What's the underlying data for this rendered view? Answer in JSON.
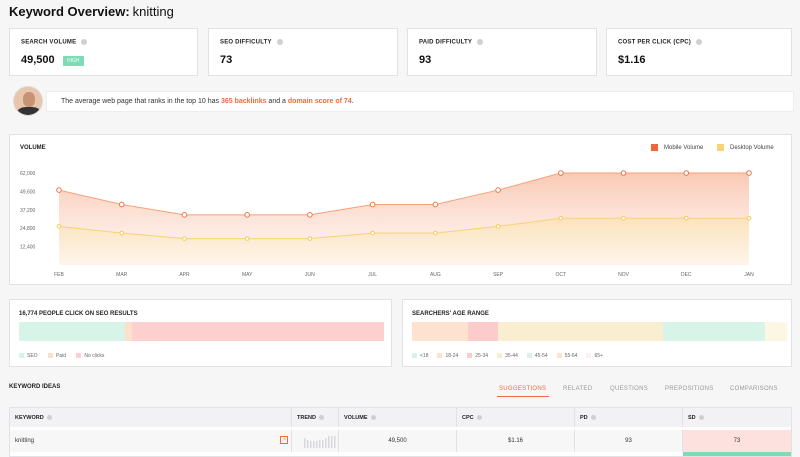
{
  "header": {
    "title": "Keyword Overview:",
    "keyword": "knitting"
  },
  "metrics": [
    {
      "label": "SEARCH VOLUME",
      "value": "49,500",
      "badge": "HIGH"
    },
    {
      "label": "SEO DIFFICULTY",
      "value": "73"
    },
    {
      "label": "PAID DIFFICULTY",
      "value": "93"
    },
    {
      "label": "COST PER CLICK (CPC)",
      "value": "$1.16"
    }
  ],
  "advice": {
    "prefix": "The average web page that ranks in the top 10 has ",
    "backlinks": "365 backlinks",
    "middle": " and a ",
    "domain_score": "domain score of 74",
    "suffix": "."
  },
  "volume_chart": {
    "title": "VOLUME",
    "legend_mobile": "Mobile Volume",
    "legend_desktop": "Desktop Volume",
    "colors": {
      "mobile": "#f5a07a",
      "desktop": "#f7d277"
    }
  },
  "chart_data": {
    "type": "area",
    "title": "VOLUME",
    "categories": [
      "FEB",
      "MAR",
      "APR",
      "MAY",
      "JUN",
      "JUL",
      "AUG",
      "SEP",
      "OCT",
      "NOV",
      "DEC",
      "JAN"
    ],
    "y_ticks": [
      "62,000",
      "49,600",
      "37,200",
      "24,800",
      "12,400"
    ],
    "ylim": [
      0,
      62000
    ],
    "series": [
      {
        "name": "Mobile Volume",
        "values": [
          50500,
          40800,
          33800,
          33800,
          33800,
          40800,
          40800,
          50500,
          62000,
          62000,
          62000,
          62000
        ]
      },
      {
        "name": "Desktop Volume",
        "values": [
          26000,
          21500,
          17800,
          17800,
          17800,
          21500,
          21500,
          26000,
          31500,
          31500,
          31500,
          31500
        ]
      }
    ]
  },
  "seo_clicks": {
    "title": "16,774 PEOPLE CLICK ON SEO RESULTS",
    "segments": [
      {
        "name": "SEO",
        "color": "#d6f5e8",
        "share": 0.29
      },
      {
        "name": "Paid",
        "color": "#fde0cc",
        "share": 0.02
      },
      {
        "name": "No clicks",
        "color": "#fdd0cf",
        "share": 0.69
      }
    ],
    "legend": [
      "SEO",
      "Paid",
      "No clicks"
    ]
  },
  "age_range": {
    "title": "SEARCHERS' AGE RANGE",
    "segments": [
      {
        "name": "<18",
        "color": "#fde3cf",
        "share": 0.15
      },
      {
        "name": "18-24",
        "color": "#fccccd",
        "share": 0.08
      },
      {
        "name": "25-34",
        "color": "#faeed0",
        "share": 0.44
      },
      {
        "name": "35-44",
        "color": "#d8f4e8",
        "share": 0.27
      },
      {
        "name": "45-54",
        "color": "#fbf7e2",
        "share": 0.06
      }
    ],
    "legend": [
      {
        "label": "<18",
        "color": "#d8f4e8"
      },
      {
        "label": "18-24",
        "color": "#fde3cf"
      },
      {
        "label": "25-34",
        "color": "#fccccd"
      },
      {
        "label": "35-44",
        "color": "#faeed0"
      },
      {
        "label": "45-54",
        "color": "#d8f4e8"
      },
      {
        "label": "55-64",
        "color": "#fde3cf"
      },
      {
        "label": "65+",
        "color": "#fdf0f0"
      }
    ]
  },
  "keyword_ideas": {
    "title": "KEYWORD IDEAS",
    "tabs": [
      "SUGGESTIONS",
      "RELATED",
      "QUESTIONS",
      "PREPOSITIONS",
      "COMPARISONS"
    ],
    "columns": [
      "KEYWORD",
      "TREND",
      "VOLUME",
      "CPC",
      "PD",
      "SD"
    ],
    "rows": [
      {
        "keyword": "knitting",
        "volume": "49,500",
        "cpc": "$1.16",
        "pd": "93",
        "sd": "73"
      }
    ]
  }
}
